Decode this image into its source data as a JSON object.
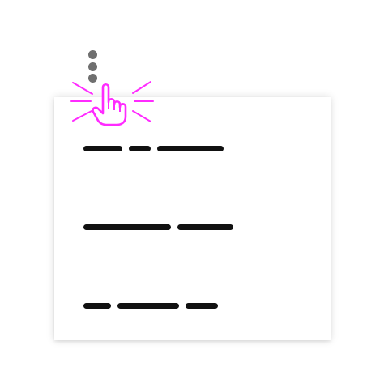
{
  "overflow_button": {
    "icon": "vertical-ellipsis-icon",
    "dot_color": "#6f6f6f"
  },
  "menu": {
    "items": [
      {
        "placeholder_segments": 3
      },
      {
        "placeholder_segments": 2
      },
      {
        "placeholder_segments": 3
      }
    ]
  },
  "cursor": {
    "icon": "pointing-hand-cursor-icon",
    "state": "clicking",
    "highlight_color": "#ff2bff"
  }
}
